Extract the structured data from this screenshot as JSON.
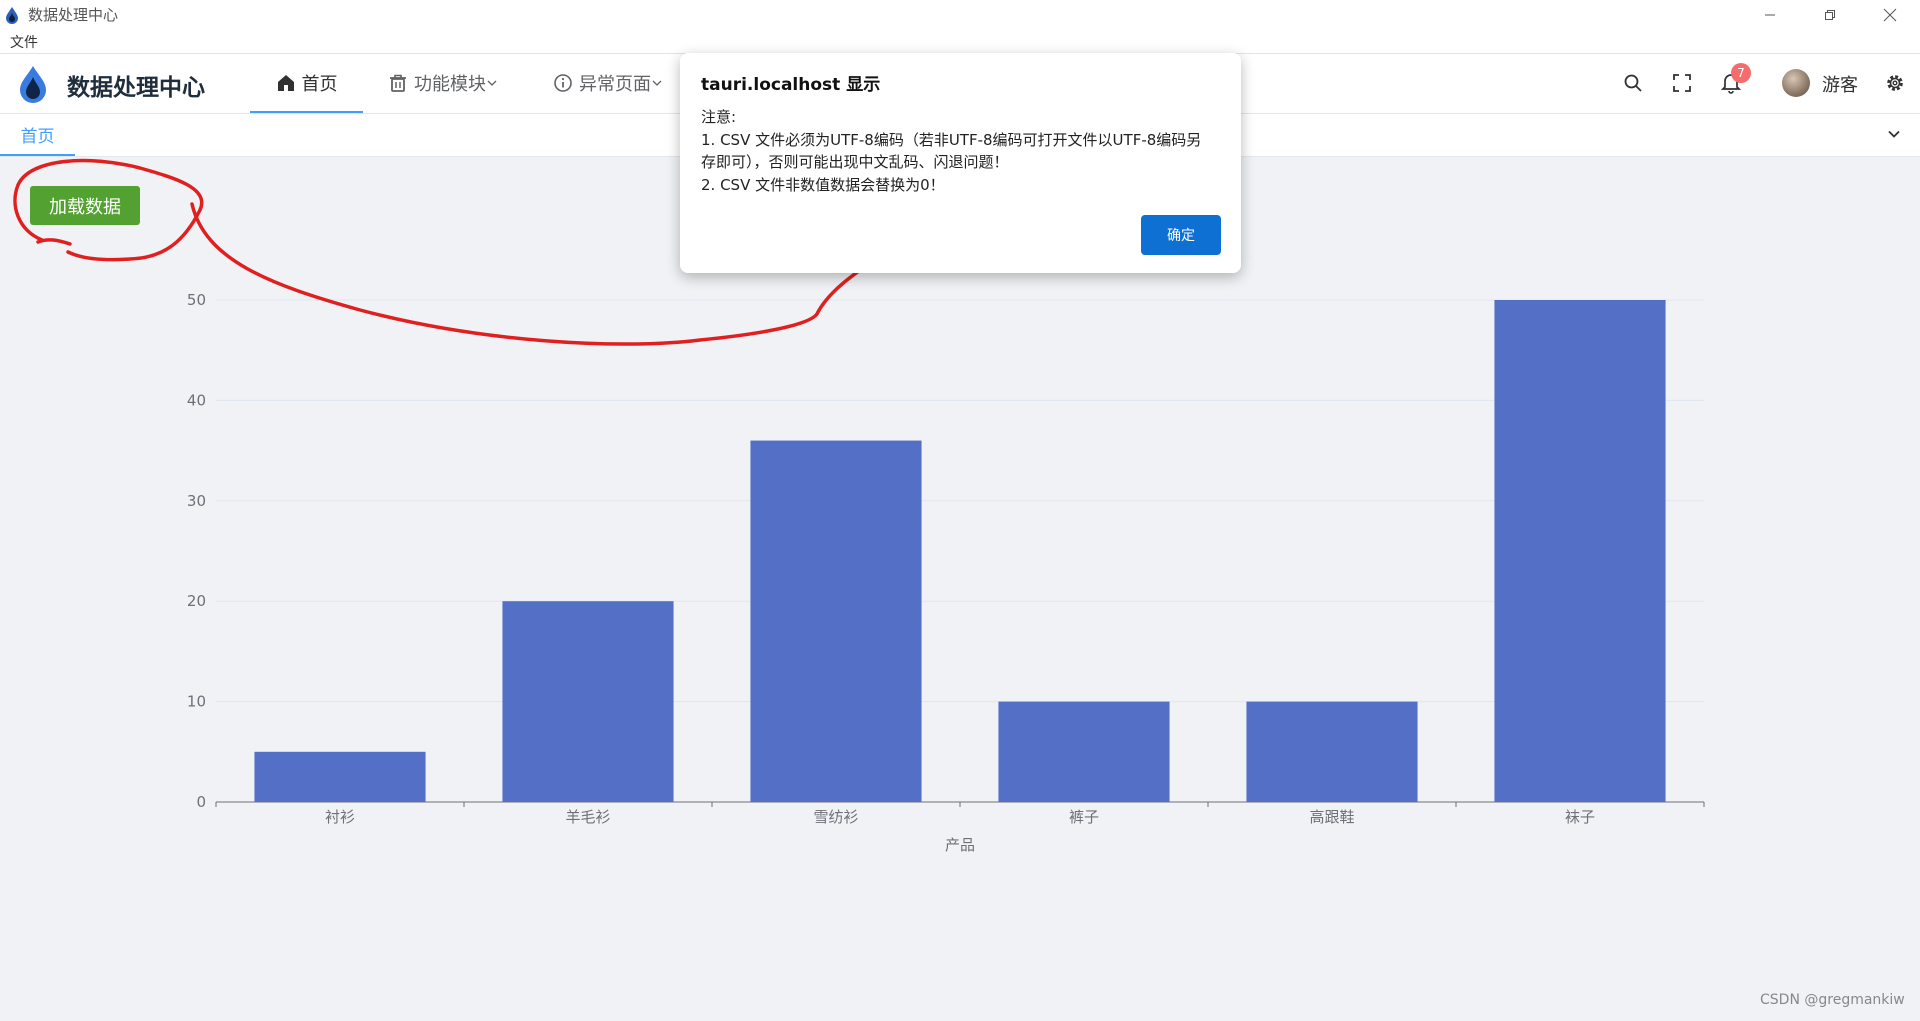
{
  "window": {
    "title": "数据处理中心"
  },
  "menu": {
    "file": "文件"
  },
  "header": {
    "brand": "数据处理中心",
    "nav": [
      {
        "label": "首页",
        "icon": "home-icon",
        "active": true
      },
      {
        "label": "功能模块",
        "icon": "trash-bin-icon",
        "dropdown": true
      },
      {
        "label": "异常页面",
        "icon": "info-circle-icon",
        "dropdown": true
      }
    ],
    "notification_count": "7",
    "user_name": "游客"
  },
  "tabs": [
    {
      "label": "首页",
      "active": true
    }
  ],
  "actions": {
    "load_button": "加载数据"
  },
  "dialog": {
    "title": "tauri.localhost 显示",
    "message_lines": [
      "注意:",
      "1. CSV 文件必须为UTF-8编码（若非UTF-8编码可打开文件以UTF-8编码另",
      "存即可），否则可能出现中文乱码、闪退问题！",
      "2. CSV 文件非数值数据会替换为0！"
    ],
    "ok_label": "确定"
  },
  "chart_data": {
    "type": "bar",
    "categories": [
      "衬衫",
      "羊毛衫",
      "雪纺衫",
      "裤子",
      "高跟鞋",
      "袜子"
    ],
    "values": [
      5,
      20,
      36,
      10,
      10,
      50
    ],
    "xlabel": "产品",
    "ylabel": "",
    "ylim": [
      0,
      50
    ],
    "yticks": [
      0,
      10,
      20,
      30,
      40,
      50
    ],
    "color": "#5470c6",
    "grid": true
  },
  "watermark": "CSDN @gregmankiw",
  "colors": {
    "accent": "#409eff",
    "load_button": "#53a231",
    "dialog_ok": "#0e70d3",
    "annotation": "#e02020"
  }
}
